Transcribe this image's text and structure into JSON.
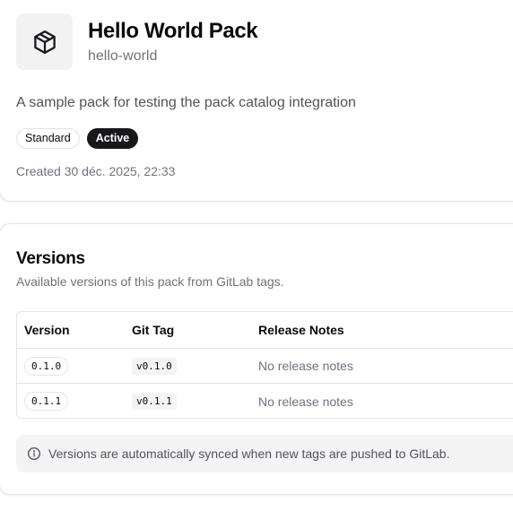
{
  "pack": {
    "icon": "package-icon",
    "title": "Hello World Pack",
    "slug": "hello-world",
    "description": "A sample pack for testing the pack catalog integration",
    "badges": [
      "Standard",
      "Active"
    ],
    "created": "Created 30 déc. 2025, 22:33"
  },
  "versions": {
    "title": "Versions",
    "subtitle": "Available versions of this pack from GitLab tags.",
    "columns": [
      "Version",
      "Git Tag",
      "Release Notes"
    ],
    "rows": [
      {
        "version": "0.1.0",
        "tag": "v0.1.0",
        "notes": "No release notes"
      },
      {
        "version": "0.1.1",
        "tag": "v0.1.1",
        "notes": "No release notes"
      }
    ],
    "info_icon": "info-icon",
    "info": "Versions are automatically synced when new tags are pushed to GitLab."
  },
  "colors": {
    "muted_text": "#71717a",
    "active_badge": "#18181b",
    "icon_bg": "#f2f2f3",
    "border": "#e4e4e7"
  }
}
